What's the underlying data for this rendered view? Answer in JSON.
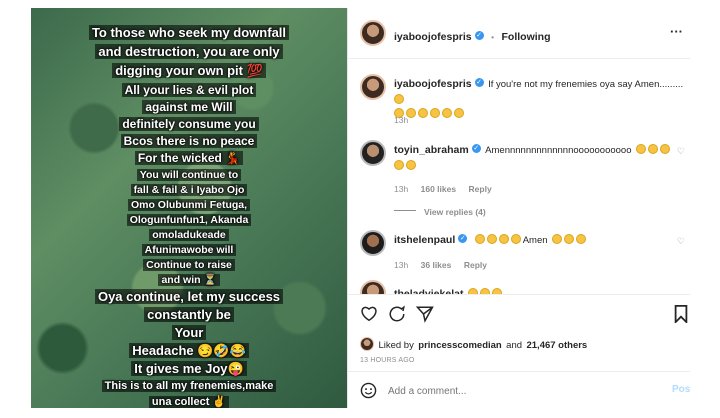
{
  "caption_lines": [
    {
      "t": "To those who seek my downfall",
      "s": 13
    },
    {
      "t": "and destruction, you are only",
      "s": 13
    },
    {
      "t": "digging your own pit 💯",
      "s": 13
    },
    {
      "t": "All your lies & evil plot",
      "s": 12
    },
    {
      "t": "against me Will",
      "s": 12
    },
    {
      "t": "definitely consume you",
      "s": 12
    },
    {
      "t": "Bcos there is no peace",
      "s": 12
    },
    {
      "t": "For the wicked 💃",
      "s": 12
    },
    {
      "t": "You will continue to",
      "s": 10.5
    },
    {
      "t": "fall & fail & i Iyabo Ojo",
      "s": 10.5
    },
    {
      "t": "Omo Olubunmi Fetuga,",
      "s": 10.5
    },
    {
      "t": "Ologunfunfun1, Akanda",
      "s": 10.5
    },
    {
      "t": "omoladukeade",
      "s": 10.5
    },
    {
      "t": "Afunimawobe will",
      "s": 10.5
    },
    {
      "t": "Continue to raise",
      "s": 10.5
    },
    {
      "t": "and win ⏳",
      "s": 10.5
    },
    {
      "t": "Oya continue, let my success",
      "s": 13
    },
    {
      "t": "constantly be",
      "s": 13
    },
    {
      "t": "Your",
      "s": 13
    },
    {
      "t": "Headache 😏🤣😂",
      "s": 13
    },
    {
      "t": "It gives me Joy😜",
      "s": 13
    },
    {
      "t": "This is to all my frenemies,make",
      "s": 11
    },
    {
      "t": "una collect ✌",
      "s": 11
    }
  ],
  "header": {
    "username": "iyaboojofespris",
    "dot": "•",
    "follow": "Following",
    "more": "···"
  },
  "post_comment": {
    "username": "iyaboojofespris",
    "text": "If you're not my frenemies oya say Amen.........",
    "time": "13h"
  },
  "comments": [
    {
      "username": "toyin_abraham",
      "text": "Amennnnnnnnnnnnnooooooooooo",
      "time": "13h",
      "likes": "160 likes",
      "reply": "Reply",
      "view_replies": "View replies (4)"
    },
    {
      "username": "itshelenpaul",
      "text": "Amen",
      "time": "13h",
      "likes": "36 likes",
      "reply": "Reply"
    },
    {
      "username": "theladyiekelat",
      "text": ""
    }
  ],
  "likes": {
    "prefix": "Liked by",
    "user": "princesscomedian",
    "middle": "and",
    "count": "21,467 others"
  },
  "timestamp": "13 HOURS AGO",
  "add_comment": {
    "placeholder": "Add a comment...",
    "post": "Post"
  },
  "colors": {
    "accent": "#3897f0",
    "text": "#262626",
    "muted": "#8e8e8e"
  }
}
